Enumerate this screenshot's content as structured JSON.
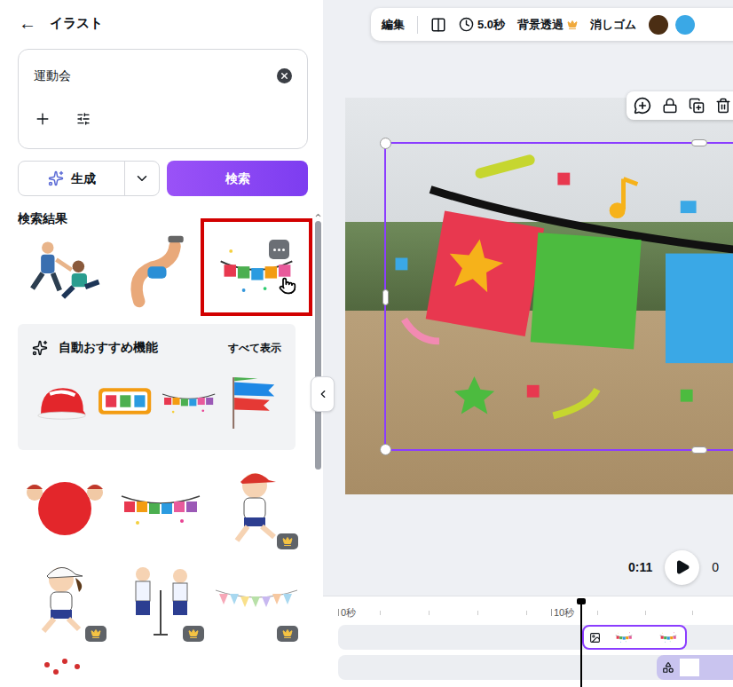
{
  "panel": {
    "back": "←",
    "title": "イラスト"
  },
  "search": {
    "value": "運動会"
  },
  "actions": {
    "generate": "生成",
    "search": "検索"
  },
  "results_label": "検索結果",
  "results": [
    {
      "kind": "athletes",
      "selected": false,
      "premium": false
    },
    {
      "kind": "arm",
      "selected": false,
      "premium": false
    },
    {
      "kind": "banner",
      "selected": true,
      "premium": false
    }
  ],
  "recommend": {
    "title": "自動おすすめ機能",
    "show_all": "すべて表示",
    "items": [
      {
        "kind": "helmet"
      },
      {
        "kind": "frame"
      },
      {
        "kind": "bunting"
      },
      {
        "kind": "carp"
      }
    ]
  },
  "more_results": [
    {
      "kind": "ball",
      "premium": false
    },
    {
      "kind": "bunting",
      "premium": false
    },
    {
      "kind": "runner-boy",
      "premium": true
    },
    {
      "kind": "runner-girl",
      "premium": true
    },
    {
      "kind": "singers",
      "premium": true
    },
    {
      "kind": "pennants",
      "premium": true
    },
    {
      "kind": "dots",
      "premium": false
    }
  ],
  "toolbar": {
    "edit": "編集",
    "duration": "5.0秒",
    "bg_remove": "背景透過",
    "bg_remove_premium": true,
    "eraser": "消しゴム",
    "colors": [
      "#4b2e14",
      "#3aa8e6"
    ]
  },
  "playback": {
    "time": "0:11",
    "total": "0"
  },
  "timeline": {
    "ticks": [
      "0秒",
      "10秒"
    ]
  }
}
